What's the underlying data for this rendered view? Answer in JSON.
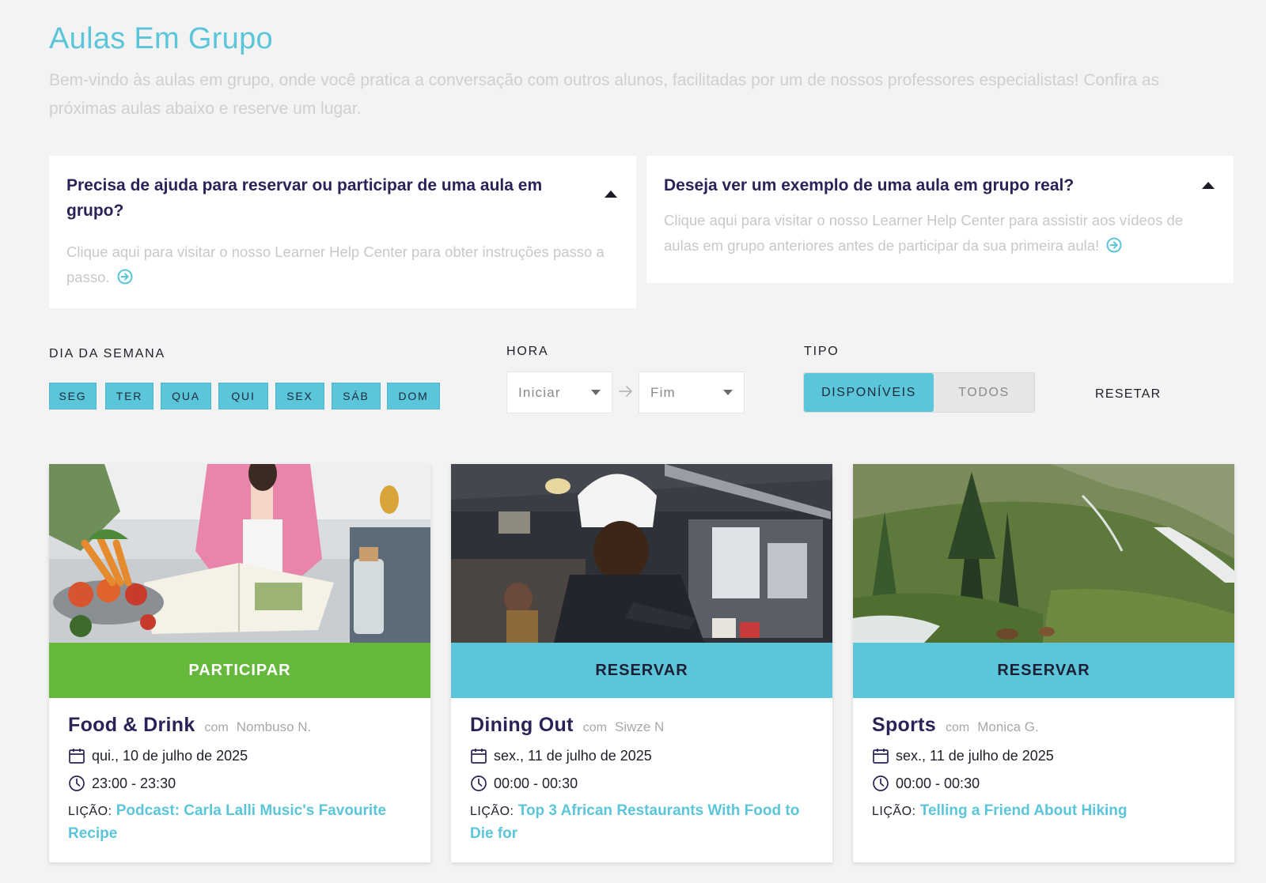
{
  "header": {
    "title": "Aulas Em Grupo",
    "intro": "Bem-vindo às aulas em grupo, onde você pratica a conversação com outros alunos, facilitadas por um de nossos professores especialistas! Confira as próximas aulas abaixo e reserve um lugar."
  },
  "help_cards": [
    {
      "title": "Precisa de ajuda para reservar ou participar de uma aula em grupo?",
      "body": "Clique aqui para visitar o nosso Learner Help Center para obter instruções passo a passo."
    },
    {
      "title": "Deseja ver um exemplo de uma aula em grupo real?",
      "body": "Clique aqui para visitar o nosso Learner Help Center para assistir aos vídeos de aulas em grupo anteriores antes de participar da sua primeira aula!"
    }
  ],
  "filters": {
    "day_label": "DIA DA SEMANA",
    "days": [
      "SEG",
      "TER",
      "QUA",
      "QUI",
      "SEX",
      "SÁB",
      "DOM"
    ],
    "time_label": "HORA",
    "start_placeholder": "Iniciar",
    "end_placeholder": "Fim",
    "type_label": "TIPO",
    "type_options": [
      "DISPONÍVEIS",
      "TODOS"
    ],
    "type_selected": "DISPONÍVEIS",
    "reset_label": "RESETAR"
  },
  "colors": {
    "accent": "#5bc5da",
    "join_green": "#66b83d",
    "title_navy": "#2b2257"
  },
  "classes": [
    {
      "action": "PARTICIPAR",
      "title": "Food & Drink",
      "with": "com",
      "teacher": "Nombuso N.",
      "date": "qui., 10 de julho de 2025",
      "time": "23:00 - 23:30",
      "lesson_label": "LIÇÃO:",
      "lesson": "Podcast: Carla Lalli Music's Favourite Recipe"
    },
    {
      "action": "RESERVAR",
      "title": "Dining Out",
      "with": "com",
      "teacher": "Siwze N",
      "date": "sex., 11 de julho de 2025",
      "time": "00:00 - 00:30",
      "lesson_label": "LIÇÃO:",
      "lesson": "Top 3 African Restaurants With Food to Die for"
    },
    {
      "action": "RESERVAR",
      "title": "Sports",
      "with": "com",
      "teacher": "Monica G.",
      "date": "sex., 11 de julho de 2025",
      "time": "00:00 - 00:30",
      "lesson_label": "LIÇÃO:",
      "lesson": "Telling a Friend About Hiking"
    }
  ]
}
